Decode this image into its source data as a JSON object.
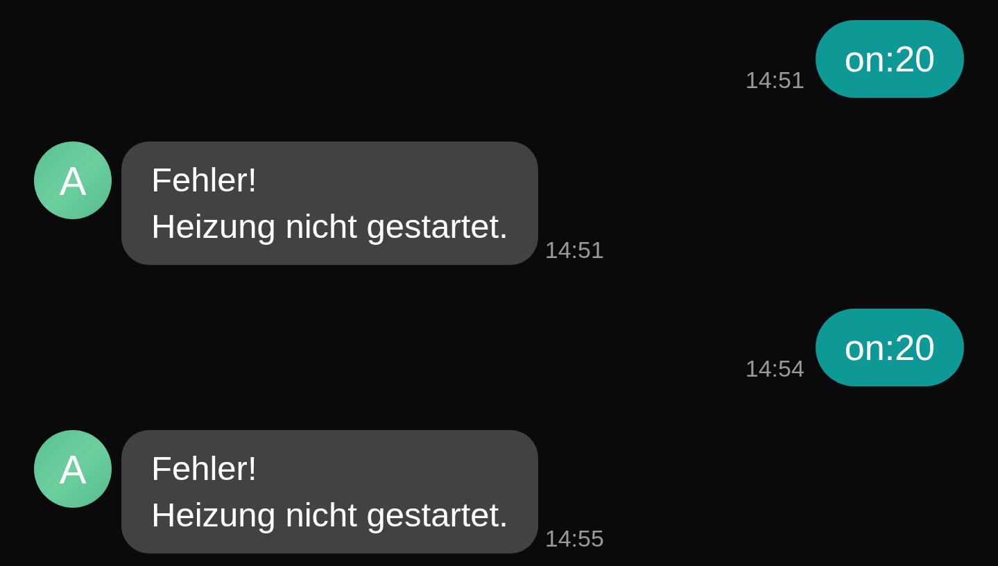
{
  "messages": [
    {
      "kind": "sent",
      "lines": [
        "on:20"
      ],
      "time": "14:51"
    },
    {
      "kind": "received",
      "avatar": "A",
      "lines": [
        "Fehler!",
        "Heizung nicht gestartet."
      ],
      "time": "14:51"
    },
    {
      "kind": "sent",
      "lines": [
        "on:20"
      ],
      "time": "14:54"
    },
    {
      "kind": "received",
      "avatar": "A",
      "lines": [
        "Fehler!",
        "Heizung nicht gestartet."
      ],
      "time": "14:55"
    }
  ]
}
